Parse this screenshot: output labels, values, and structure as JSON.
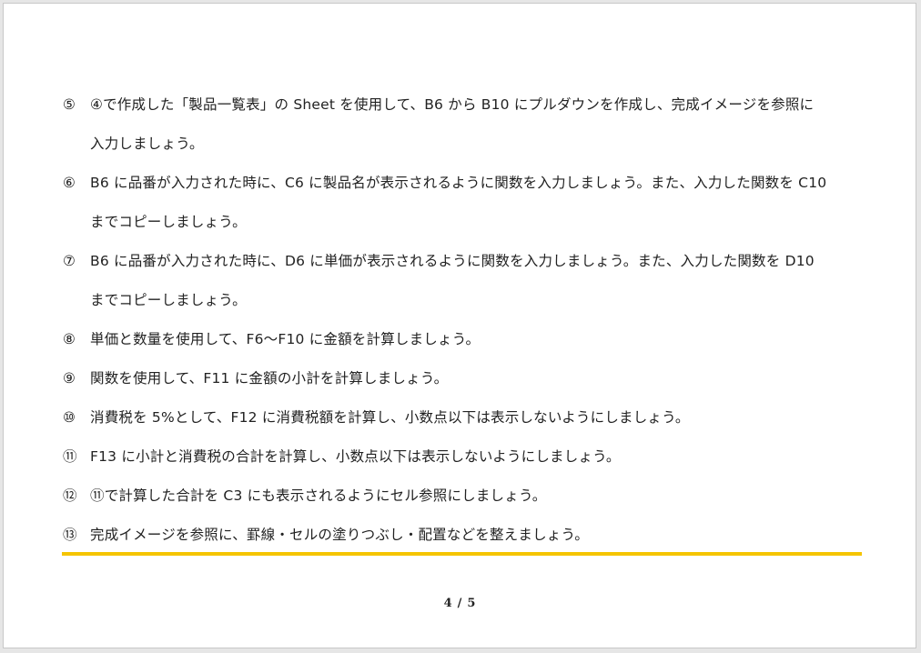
{
  "document": {
    "items": [
      {
        "marker": "⑤",
        "lines": [
          "④で作成した「製品一覧表」の Sheet を使用して、B6 から B10 にプルダウンを作成し、完成イメージを参照に",
          "入力しましょう。"
        ]
      },
      {
        "marker": "⑥",
        "lines": [
          "B6 に品番が入力された時に、C6 に製品名が表示されるように関数を入力しましょう。また、入力した関数を C10",
          "までコピーしましょう。"
        ]
      },
      {
        "marker": "⑦",
        "lines": [
          "B6 に品番が入力された時に、D6 に単価が表示されるように関数を入力しましょう。また、入力した関数を D10",
          "までコピーしましょう。"
        ]
      },
      {
        "marker": "⑧",
        "lines": [
          "単価と数量を使用して、F6～F10 に金額を計算しましょう。"
        ]
      },
      {
        "marker": "⑨",
        "lines": [
          "関数を使用して、F11 に金額の小計を計算しましょう。"
        ]
      },
      {
        "marker": "⑩",
        "lines": [
          "消費税を 5%として、F12 に消費税額を計算し、小数点以下は表示しないようにしましょう。"
        ]
      },
      {
        "marker": "⑪",
        "lines": [
          "F13 に小計と消費税の合計を計算し、小数点以下は表示しないようにしましょう。"
        ]
      },
      {
        "marker": "⑫",
        "lines": [
          "⑪で計算した合計を C3 にも表示されるようにセル参照にしましょう。"
        ]
      },
      {
        "marker": "⑬",
        "lines": [
          "完成イメージを参照に、罫線・セルの塗りつぶし・配置などを整えましょう。"
        ]
      }
    ],
    "rule_color": "#f5c400",
    "page_current": "4",
    "page_separator": "/",
    "page_total": "5"
  }
}
